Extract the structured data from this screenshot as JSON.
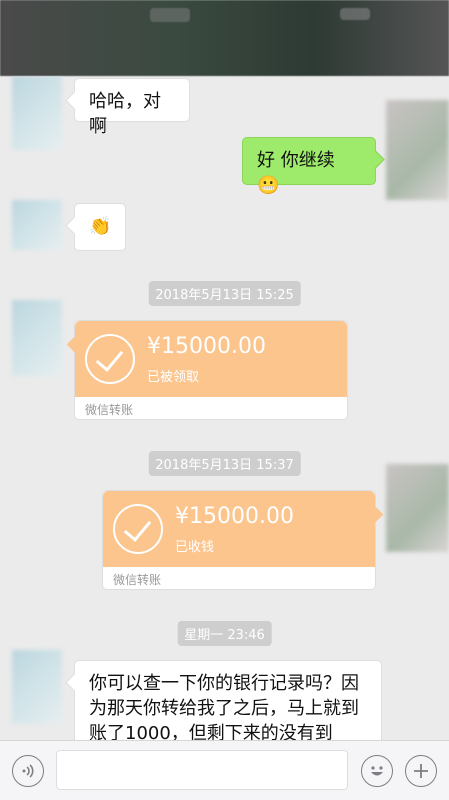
{
  "messages": {
    "m1_text": "哈哈，对啊",
    "m2_text": "好 你继续",
    "m2_emoji": "😬",
    "m3_emoji": "👏",
    "time1": "2018年5月13日 15:25",
    "transfer1": {
      "amount": "¥15000.00",
      "status": "已被领取",
      "label": "微信转账"
    },
    "time2": "2018年5月13日 15:37",
    "transfer2": {
      "amount": "¥15000.00",
      "status": "已收钱",
      "label": "微信转账"
    },
    "time3": "星期一 23:46",
    "m4_text": "你可以查一下你的银行记录吗？因为那天你转给我了之后，马上就到账了1000，但剩下来的没有到"
  },
  "colors": {
    "bubble_me": "#9eea6a",
    "transfer": "#fbc58d",
    "background": "#ebebeb"
  },
  "icons": {
    "voice": "voice-icon",
    "emoji": "smile-icon",
    "add": "plus-icon"
  }
}
